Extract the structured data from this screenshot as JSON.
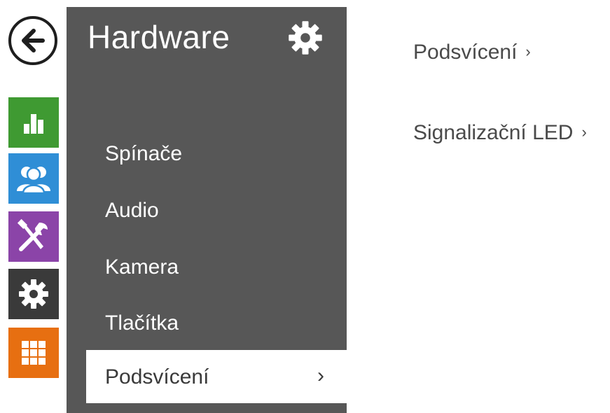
{
  "nav": {
    "back_icon": "arrow-left-icon",
    "rail": [
      {
        "icon": "bar-chart-icon",
        "color": "#3f9a32"
      },
      {
        "icon": "users-icon",
        "color": "#2f8ed6"
      },
      {
        "icon": "tools-icon",
        "color": "#8b44a8"
      },
      {
        "icon": "gear-icon",
        "color": "#3a3a3a"
      },
      {
        "icon": "grid-icon",
        "color": "#e76f11"
      }
    ]
  },
  "panel": {
    "title": "Hardware",
    "title_icon": "gear-icon",
    "background": "#575757",
    "menu": [
      {
        "label": "Spínače"
      },
      {
        "label": "Audio"
      },
      {
        "label": "Kamera"
      },
      {
        "label": "Tlačítka"
      }
    ],
    "active_item": {
      "label": "Podsvícení",
      "chevron": "›"
    }
  },
  "content": {
    "links": [
      {
        "label": "Podsvícení",
        "chevron": "›"
      },
      {
        "label": "Signalizační LED",
        "chevron": "›"
      }
    ]
  }
}
